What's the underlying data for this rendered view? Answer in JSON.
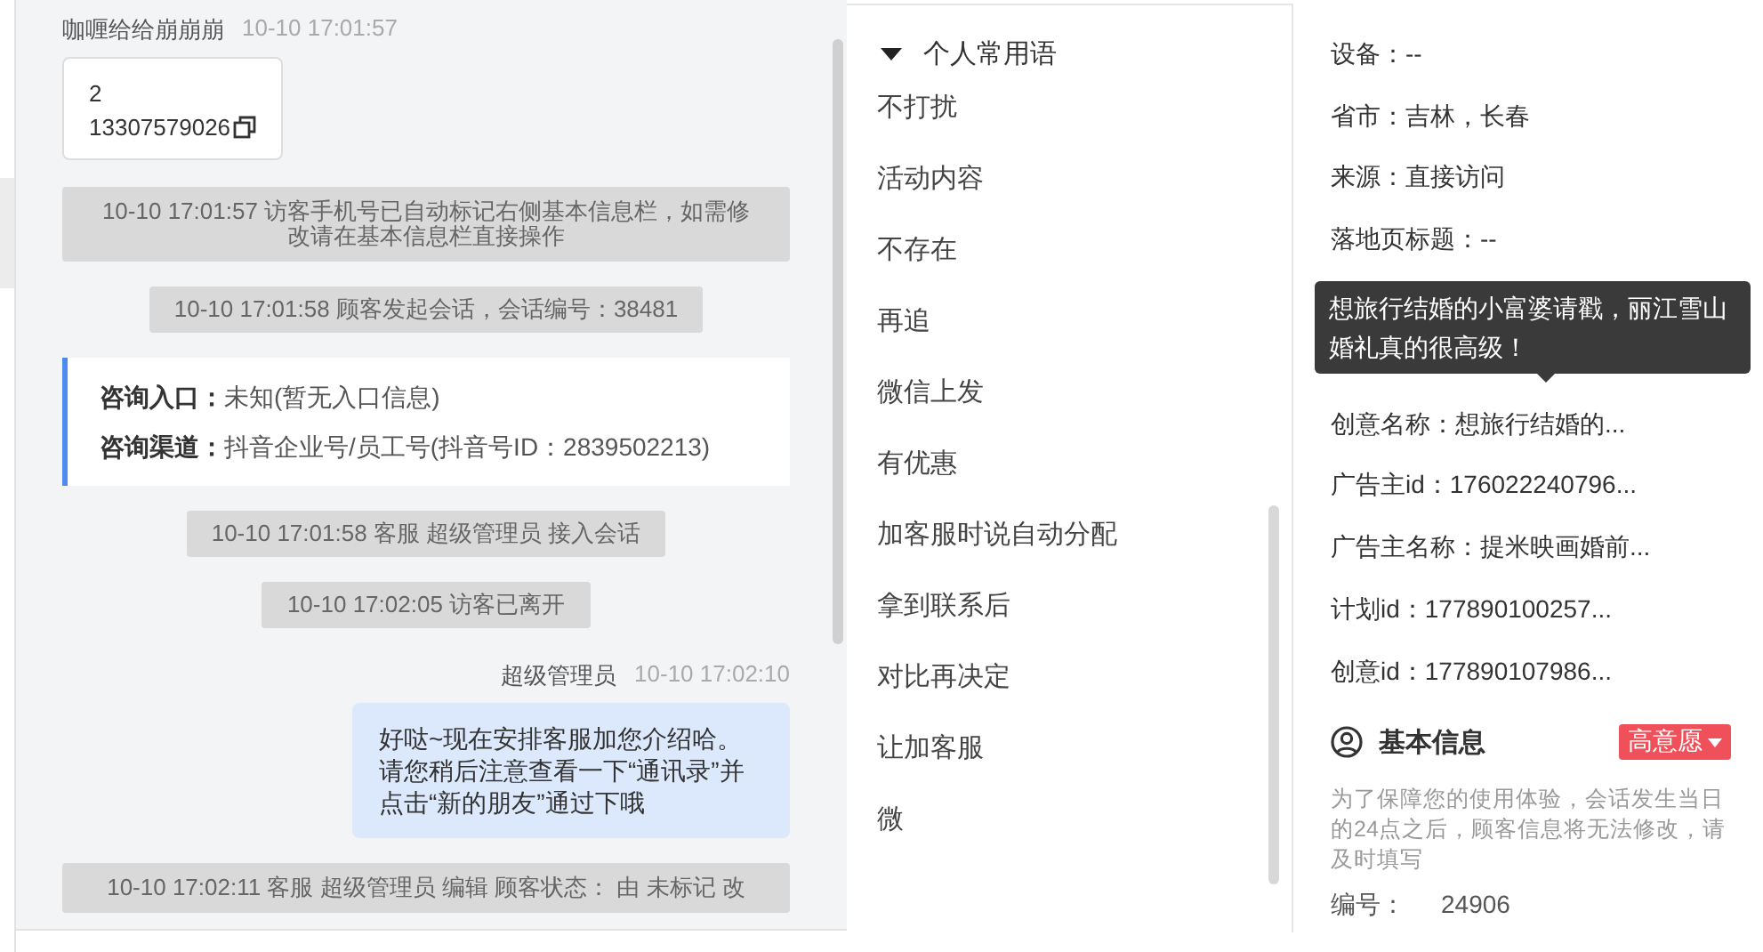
{
  "chat": {
    "messages": [
      {
        "kind": "visitor",
        "name": "咖喱给给崩崩崩",
        "time": "10-10 17:01:57",
        "lines": [
          "2",
          "13307579026"
        ]
      },
      {
        "kind": "system",
        "text": "10-10 17:01:57 访客手机号已自动标记右侧基本信息栏，如需修改请在基本信息栏直接操作",
        "wide": true
      },
      {
        "kind": "system",
        "text": "10-10 17:01:58 顾客发起会话，会话编号：38481",
        "wide": false
      },
      {
        "kind": "entry",
        "fields": [
          {
            "label": "咨询入口：",
            "value": "未知(暂无入口信息)"
          },
          {
            "label": "咨询渠道：",
            "value": "抖音企业号/员工号(抖音号ID：2839502213)"
          }
        ]
      },
      {
        "kind": "system",
        "text": "10-10 17:01:58 客服 超级管理员 接入会话",
        "wide": false
      },
      {
        "kind": "system",
        "text": "10-10 17:02:05 访客已离开",
        "wide": false
      },
      {
        "kind": "agent",
        "name": "超级管理员",
        "time": "10-10 17:02:10",
        "text": "好哒~现在安排客服加您介绍哈。请您稍后注意查看一下“通讯录”并点击“新的朋友”通过下哦"
      },
      {
        "kind": "system",
        "text": "10-10 17:02:11 客服 超级管理员 编辑 顾客状态： 由 未标记 改",
        "wide": true
      }
    ]
  },
  "phrases": {
    "group": {
      "label": "个人常用语",
      "expanded": true
    },
    "items": [
      "不打扰",
      "活动内容",
      "不存在",
      "再追",
      "微信上发",
      "有优惠",
      "加客服时说自动分配",
      "拿到联系后",
      "对比再决定",
      "让加客服",
      "微"
    ]
  },
  "visitor_info": {
    "rows": [
      "设备：--",
      "省市：吉林，长春",
      "来源：直接访问",
      "落地页标题：--",
      "创意名称：想旅行结婚的...",
      "广告主id：176022240796...",
      "广告主名称：提米映画婚前...",
      "计划id：177890100257...",
      "创意id：177890107986..."
    ],
    "tooltip": "想旅行结婚的小富婆请戳，丽江雪山婚礼真的很高级！"
  },
  "basic_info": {
    "title": "基本信息",
    "tag": "高意愿",
    "notice": "为了保障您的使用体验，会话发生当日的24点之后，顾客信息将无法修改，请及时填写",
    "fields": [
      {
        "label": "编号：",
        "value": "24906"
      }
    ]
  }
}
